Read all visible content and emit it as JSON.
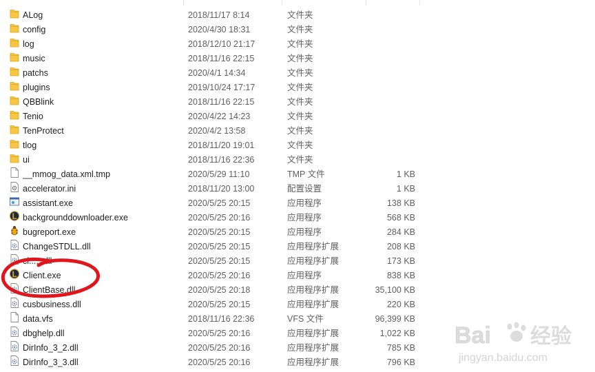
{
  "files": [
    {
      "name": "ALog",
      "date": "2018/11/17 8:14",
      "type": "文件夹",
      "size": "",
      "icon": "folder-icon"
    },
    {
      "name": "config",
      "date": "2020/4/30 18:31",
      "type": "文件夹",
      "size": "",
      "icon": "folder-icon"
    },
    {
      "name": "log",
      "date": "2018/12/10 21:17",
      "type": "文件夹",
      "size": "",
      "icon": "folder-icon"
    },
    {
      "name": "music",
      "date": "2018/11/16 22:15",
      "type": "文件夹",
      "size": "",
      "icon": "folder-icon"
    },
    {
      "name": "patchs",
      "date": "2020/4/1 14:34",
      "type": "文件夹",
      "size": "",
      "icon": "folder-icon"
    },
    {
      "name": "plugins",
      "date": "2019/10/24 17:17",
      "type": "文件夹",
      "size": "",
      "icon": "folder-icon"
    },
    {
      "name": "QBBlink",
      "date": "2018/11/16 22:15",
      "type": "文件夹",
      "size": "",
      "icon": "folder-icon"
    },
    {
      "name": "Tenio",
      "date": "2020/4/22 14:23",
      "type": "文件夹",
      "size": "",
      "icon": "folder-icon"
    },
    {
      "name": "TenProtect",
      "date": "2020/4/2 13:58",
      "type": "文件夹",
      "size": "",
      "icon": "folder-icon"
    },
    {
      "name": "tlog",
      "date": "2018/11/20 19:01",
      "type": "文件夹",
      "size": "",
      "icon": "folder-icon"
    },
    {
      "name": "ui",
      "date": "2018/11/16 22:36",
      "type": "文件夹",
      "size": "",
      "icon": "folder-icon"
    },
    {
      "name": "__mmog_data.xml.tmp",
      "date": "2020/5/29 11:10",
      "type": "TMP 文件",
      "size": "1 KB",
      "icon": "file-icon"
    },
    {
      "name": "accelerator.ini",
      "date": "2018/11/20 13:00",
      "type": "配置设置",
      "size": "1 KB",
      "icon": "settings-file-icon"
    },
    {
      "name": "assistant.exe",
      "date": "2020/5/25 20:15",
      "type": "应用程序",
      "size": "138 KB",
      "icon": "app-window-icon"
    },
    {
      "name": "backgrounddownloader.exe",
      "date": "2020/5/25 20:16",
      "type": "应用程序",
      "size": "568 KB",
      "icon": "league-logo-icon"
    },
    {
      "name": "bugreport.exe",
      "date": "2020/5/25 20:15",
      "type": "应用程序",
      "size": "284 KB",
      "icon": "bug-icon"
    },
    {
      "name": "ChangeSTDLL.dll",
      "date": "2020/5/25 20:15",
      "type": "应用程序扩展",
      "size": "208 KB",
      "icon": "dll-gear-icon"
    },
    {
      "name": "ci......dll",
      "date": "2020/5/25 20:15",
      "type": "应用程序扩展",
      "size": "173 KB",
      "icon": "dll-gear-icon"
    },
    {
      "name": "Client.exe",
      "date": "2020/5/25 20:16",
      "type": "应用程序",
      "size": "838 KB",
      "icon": "league-logo-icon"
    },
    {
      "name": "ClientBase.dll",
      "date": "2020/5/25 20:18",
      "type": "应用程序扩展",
      "size": "35,100 KB",
      "icon": "dll-gear-icon"
    },
    {
      "name": "cusbusiness.dll",
      "date": "2020/5/25 20:15",
      "type": "应用程序扩展",
      "size": "220 KB",
      "icon": "dll-gear-icon"
    },
    {
      "name": "data.vfs",
      "date": "2018/11/16 22:36",
      "type": "VFS 文件",
      "size": "96,399 KB",
      "icon": "file-icon"
    },
    {
      "name": "dbghelp.dll",
      "date": "2020/5/25 20:16",
      "type": "应用程序扩展",
      "size": "1,022 KB",
      "icon": "dll-gear-icon"
    },
    {
      "name": "DirInfo_3_2.dll",
      "date": "2020/5/25 20:16",
      "type": "应用程序扩展",
      "size": "785 KB",
      "icon": "dll-gear-icon"
    },
    {
      "name": "DirInfo_3_3.dll",
      "date": "2020/5/25 20:16",
      "type": "应用程序扩展",
      "size": "796 KB",
      "icon": "dll-gear-icon"
    }
  ],
  "watermark": {
    "brand": "Bai",
    "paw": "du",
    "cn": "经验",
    "url": "jingyan.baidu.com"
  },
  "colors": {
    "annotation": "#e0161d",
    "folder": "#f7c744",
    "folder_dark": "#dca520"
  }
}
